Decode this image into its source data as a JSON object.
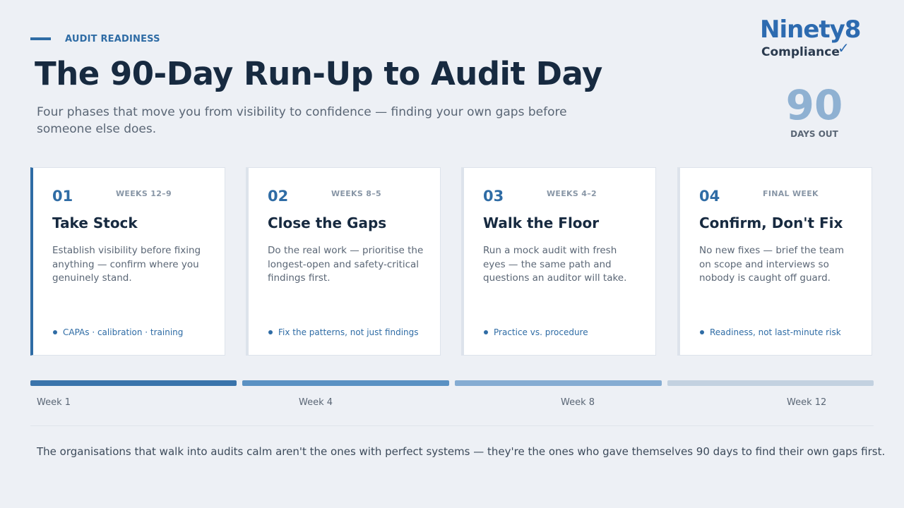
{
  "header": {
    "eyebrow": "AUDIT READINESS",
    "title": "The 90-Day Run-Up to Audit Day",
    "subtitle": "Four phases that move you from visibility to confidence — finding your own gaps before someone else does."
  },
  "logo": {
    "line1": "Ninety8",
    "line2": "Compliance",
    "check": "✓"
  },
  "countdown": {
    "value": "90",
    "label": "DAYS OUT"
  },
  "phases": [
    {
      "number": "01",
      "weeks": "WEEKS 12–9",
      "title": "Take Stock",
      "description": "Establish visibility before fixing anything — confirm where you genuinely stand.",
      "bullet": "CAPAs · calibration · training"
    },
    {
      "number": "02",
      "weeks": "WEEKS 8–5",
      "title": "Close the Gaps",
      "description": "Do the real work — prioritise the longest-open and safety-critical findings first.",
      "bullet": "Fix the patterns, not just findings"
    },
    {
      "number": "03",
      "weeks": "WEEKS 4–2",
      "title": "Walk the Floor",
      "description": "Run a mock audit with fresh eyes — the same path and questions an auditor will take.",
      "bullet": "Practice vs. procedure"
    },
    {
      "number": "04",
      "weeks": "FINAL WEEK",
      "title": "Confirm, Don't Fix",
      "description": "No new fixes — brief the team on scope and interviews so nobody is caught off guard.",
      "bullet": "Readiness, not last-minute risk"
    }
  ],
  "timeline": {
    "segment_colors": [
      "#3a74ab",
      "#5a91c3",
      "#85acd2",
      "#c3d1e0"
    ],
    "labels": [
      "Week 1",
      "Week 4",
      "Week 8",
      "Week 12"
    ]
  },
  "footer": "The organisations that walk into audits calm aren't the ones with perfect systems — they're the ones who gave themselves 90 days to find their own gaps first."
}
